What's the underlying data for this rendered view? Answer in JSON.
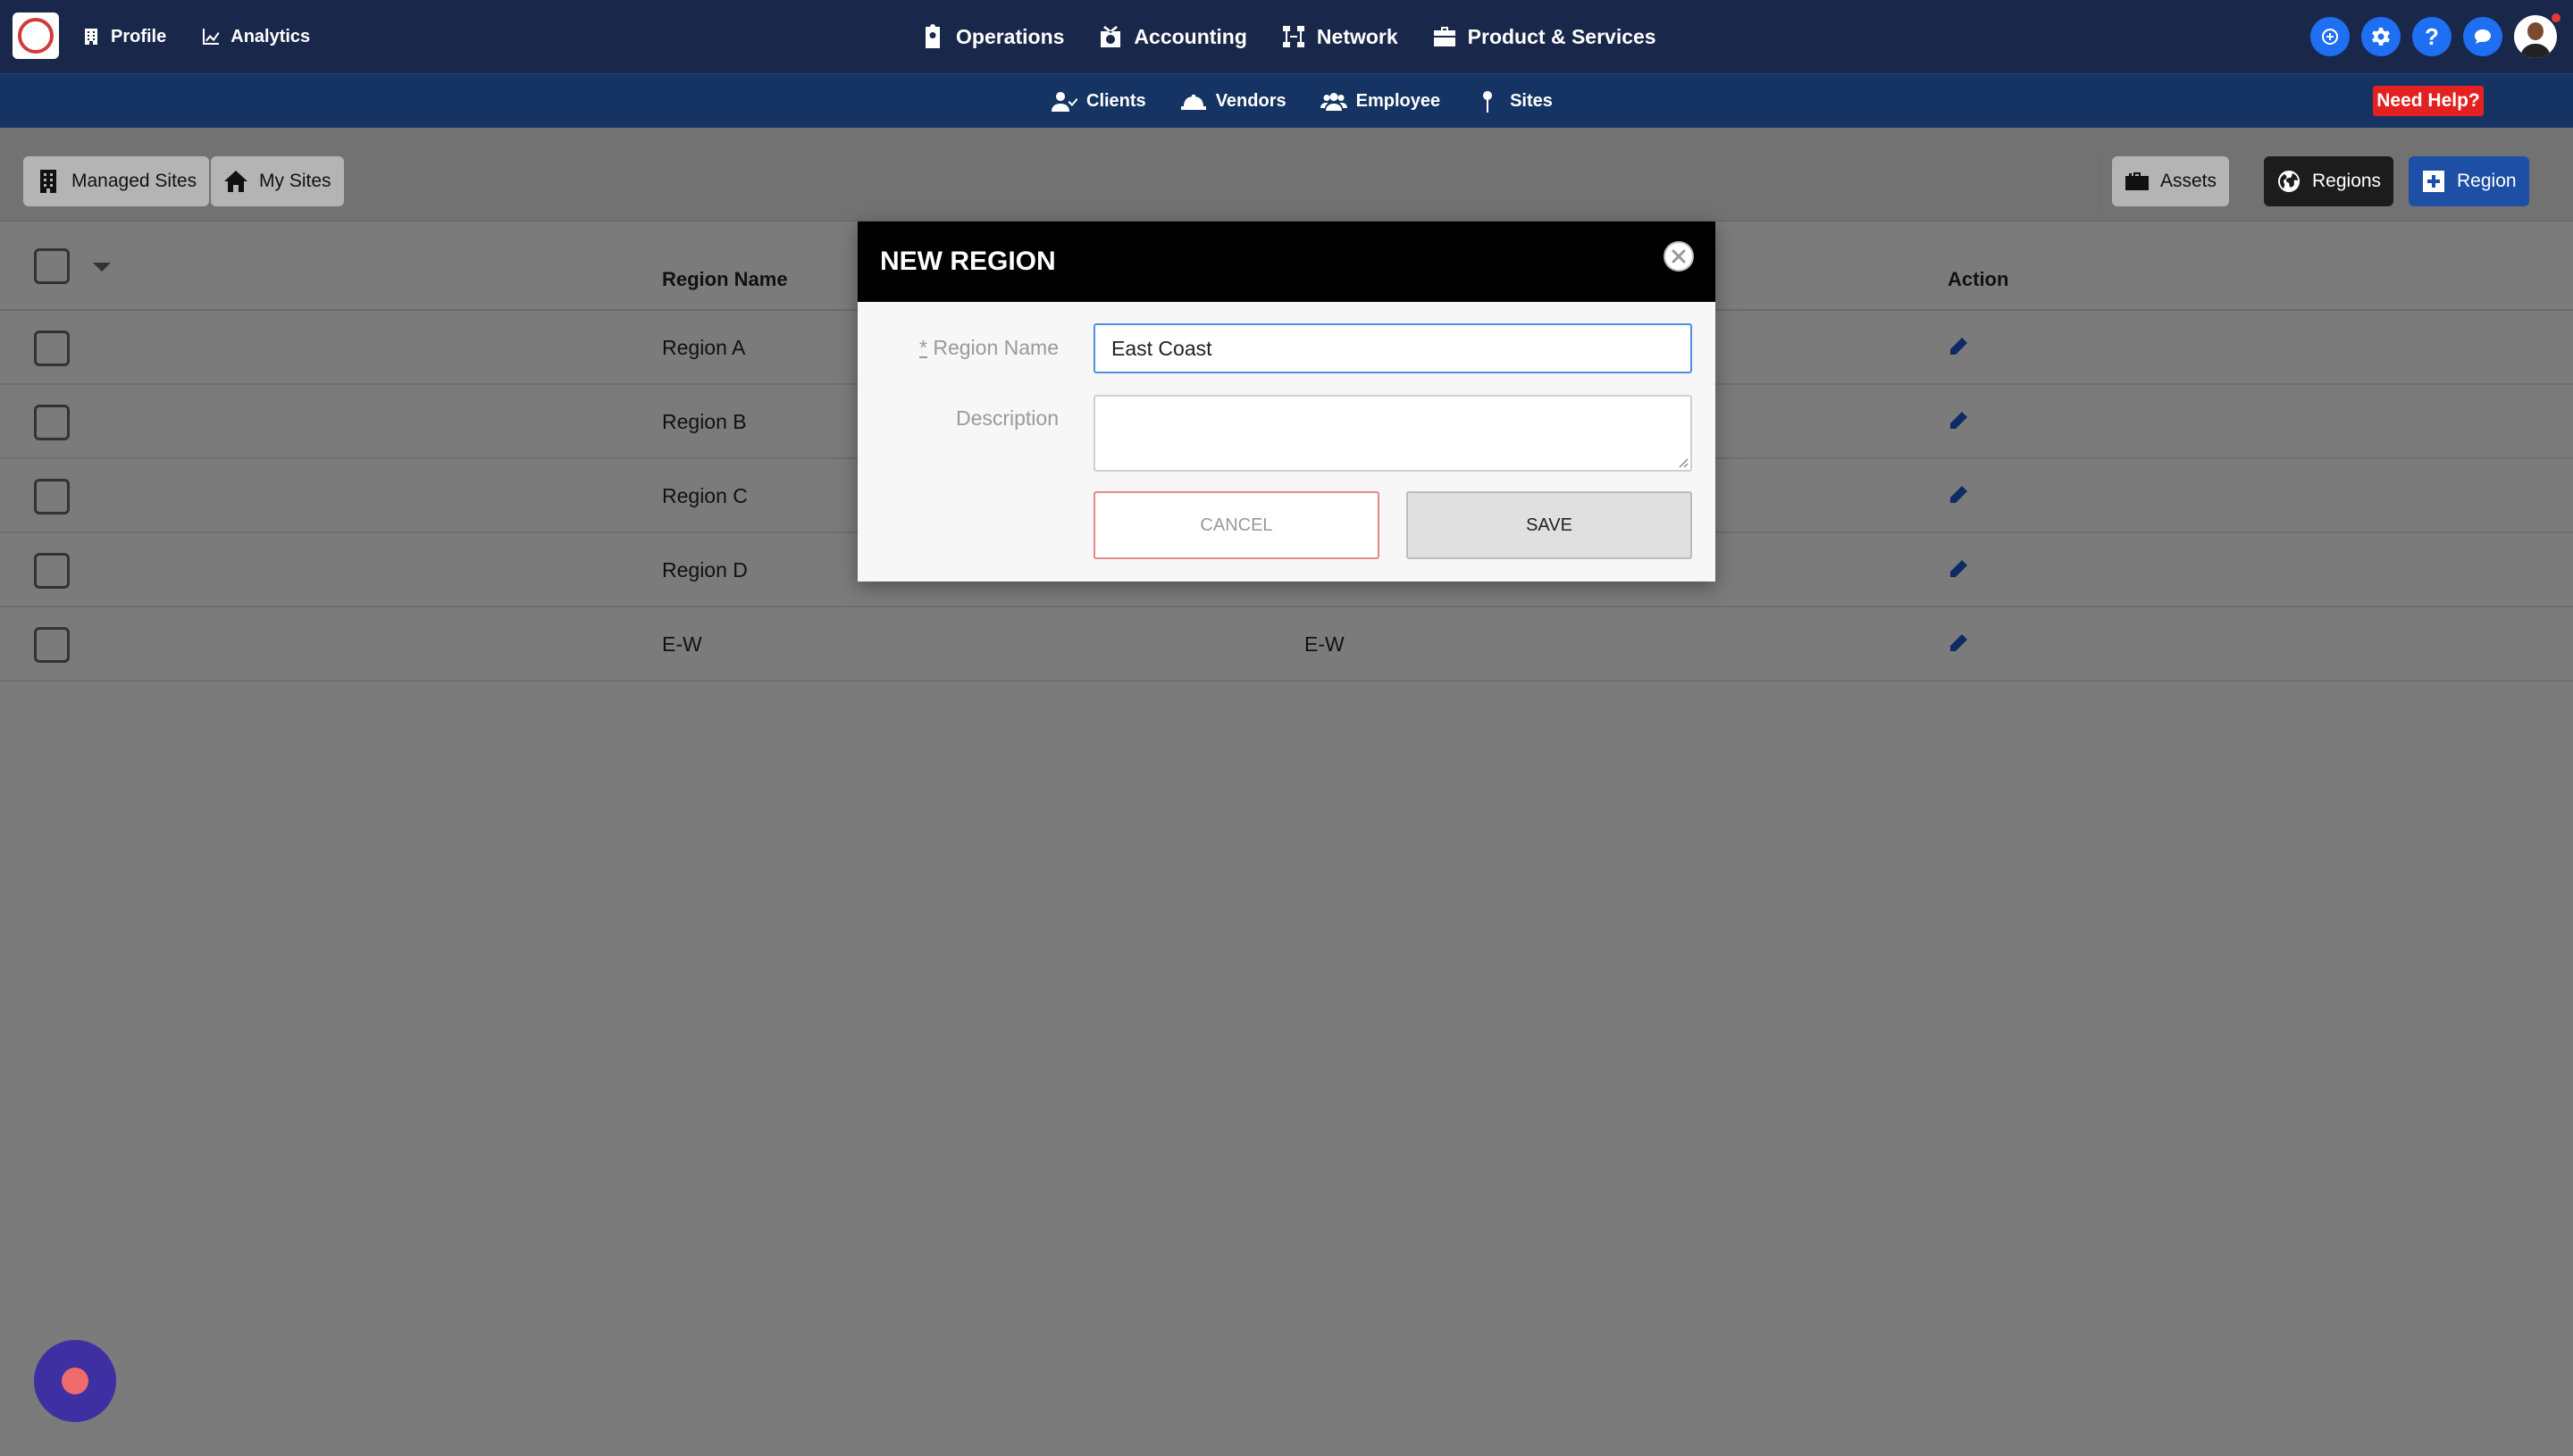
{
  "colors": {
    "topbar": "#19284a",
    "subbar": "#153463",
    "accent_blue": "#1f6ff2",
    "help_red": "#e52020",
    "overlay": "#7b7b7b"
  },
  "topnav": {
    "left": [
      {
        "label": "Profile",
        "icon": "building-icon"
      },
      {
        "label": "Analytics",
        "icon": "chart-line-icon"
      }
    ],
    "center": [
      {
        "label": "Operations",
        "icon": "clipboard-user-icon"
      },
      {
        "label": "Accounting",
        "icon": "money-box-icon"
      },
      {
        "label": "Network",
        "icon": "network-icon"
      },
      {
        "label": "Product & Services",
        "icon": "briefcase-icon"
      }
    ],
    "right_icons": [
      "add-circle-icon",
      "gear-icon",
      "question-icon",
      "chat-icon",
      "avatar"
    ]
  },
  "subnav": {
    "items": [
      {
        "label": "Clients",
        "icon": "user-check-icon"
      },
      {
        "label": "Vendors",
        "icon": "hardhat-icon"
      },
      {
        "label": "Employee",
        "icon": "users-icon"
      },
      {
        "label": "Sites",
        "icon": "map-pin-icon"
      }
    ],
    "help_label": "Need Help?"
  },
  "toolbar": {
    "managed_sites": "Managed Sites",
    "my_sites": "My Sites",
    "assets": "Assets",
    "regions": "Regions",
    "add_region": "Region"
  },
  "table": {
    "headers": {
      "region_name": "Region Name",
      "action": "Action"
    },
    "rows": [
      {
        "name": "Region A",
        "description": ""
      },
      {
        "name": "Region B",
        "description": ""
      },
      {
        "name": "Region C",
        "description": ""
      },
      {
        "name": "Region D",
        "description": ""
      },
      {
        "name": "E-W",
        "description": "E-W"
      }
    ]
  },
  "modal": {
    "title": "NEW REGION",
    "region_name_label": "Region Name",
    "required_mark": "*",
    "region_name_value": "East Coast",
    "description_label": "Description",
    "description_value": "",
    "cancel_label": "CANCEL",
    "save_label": "SAVE"
  }
}
